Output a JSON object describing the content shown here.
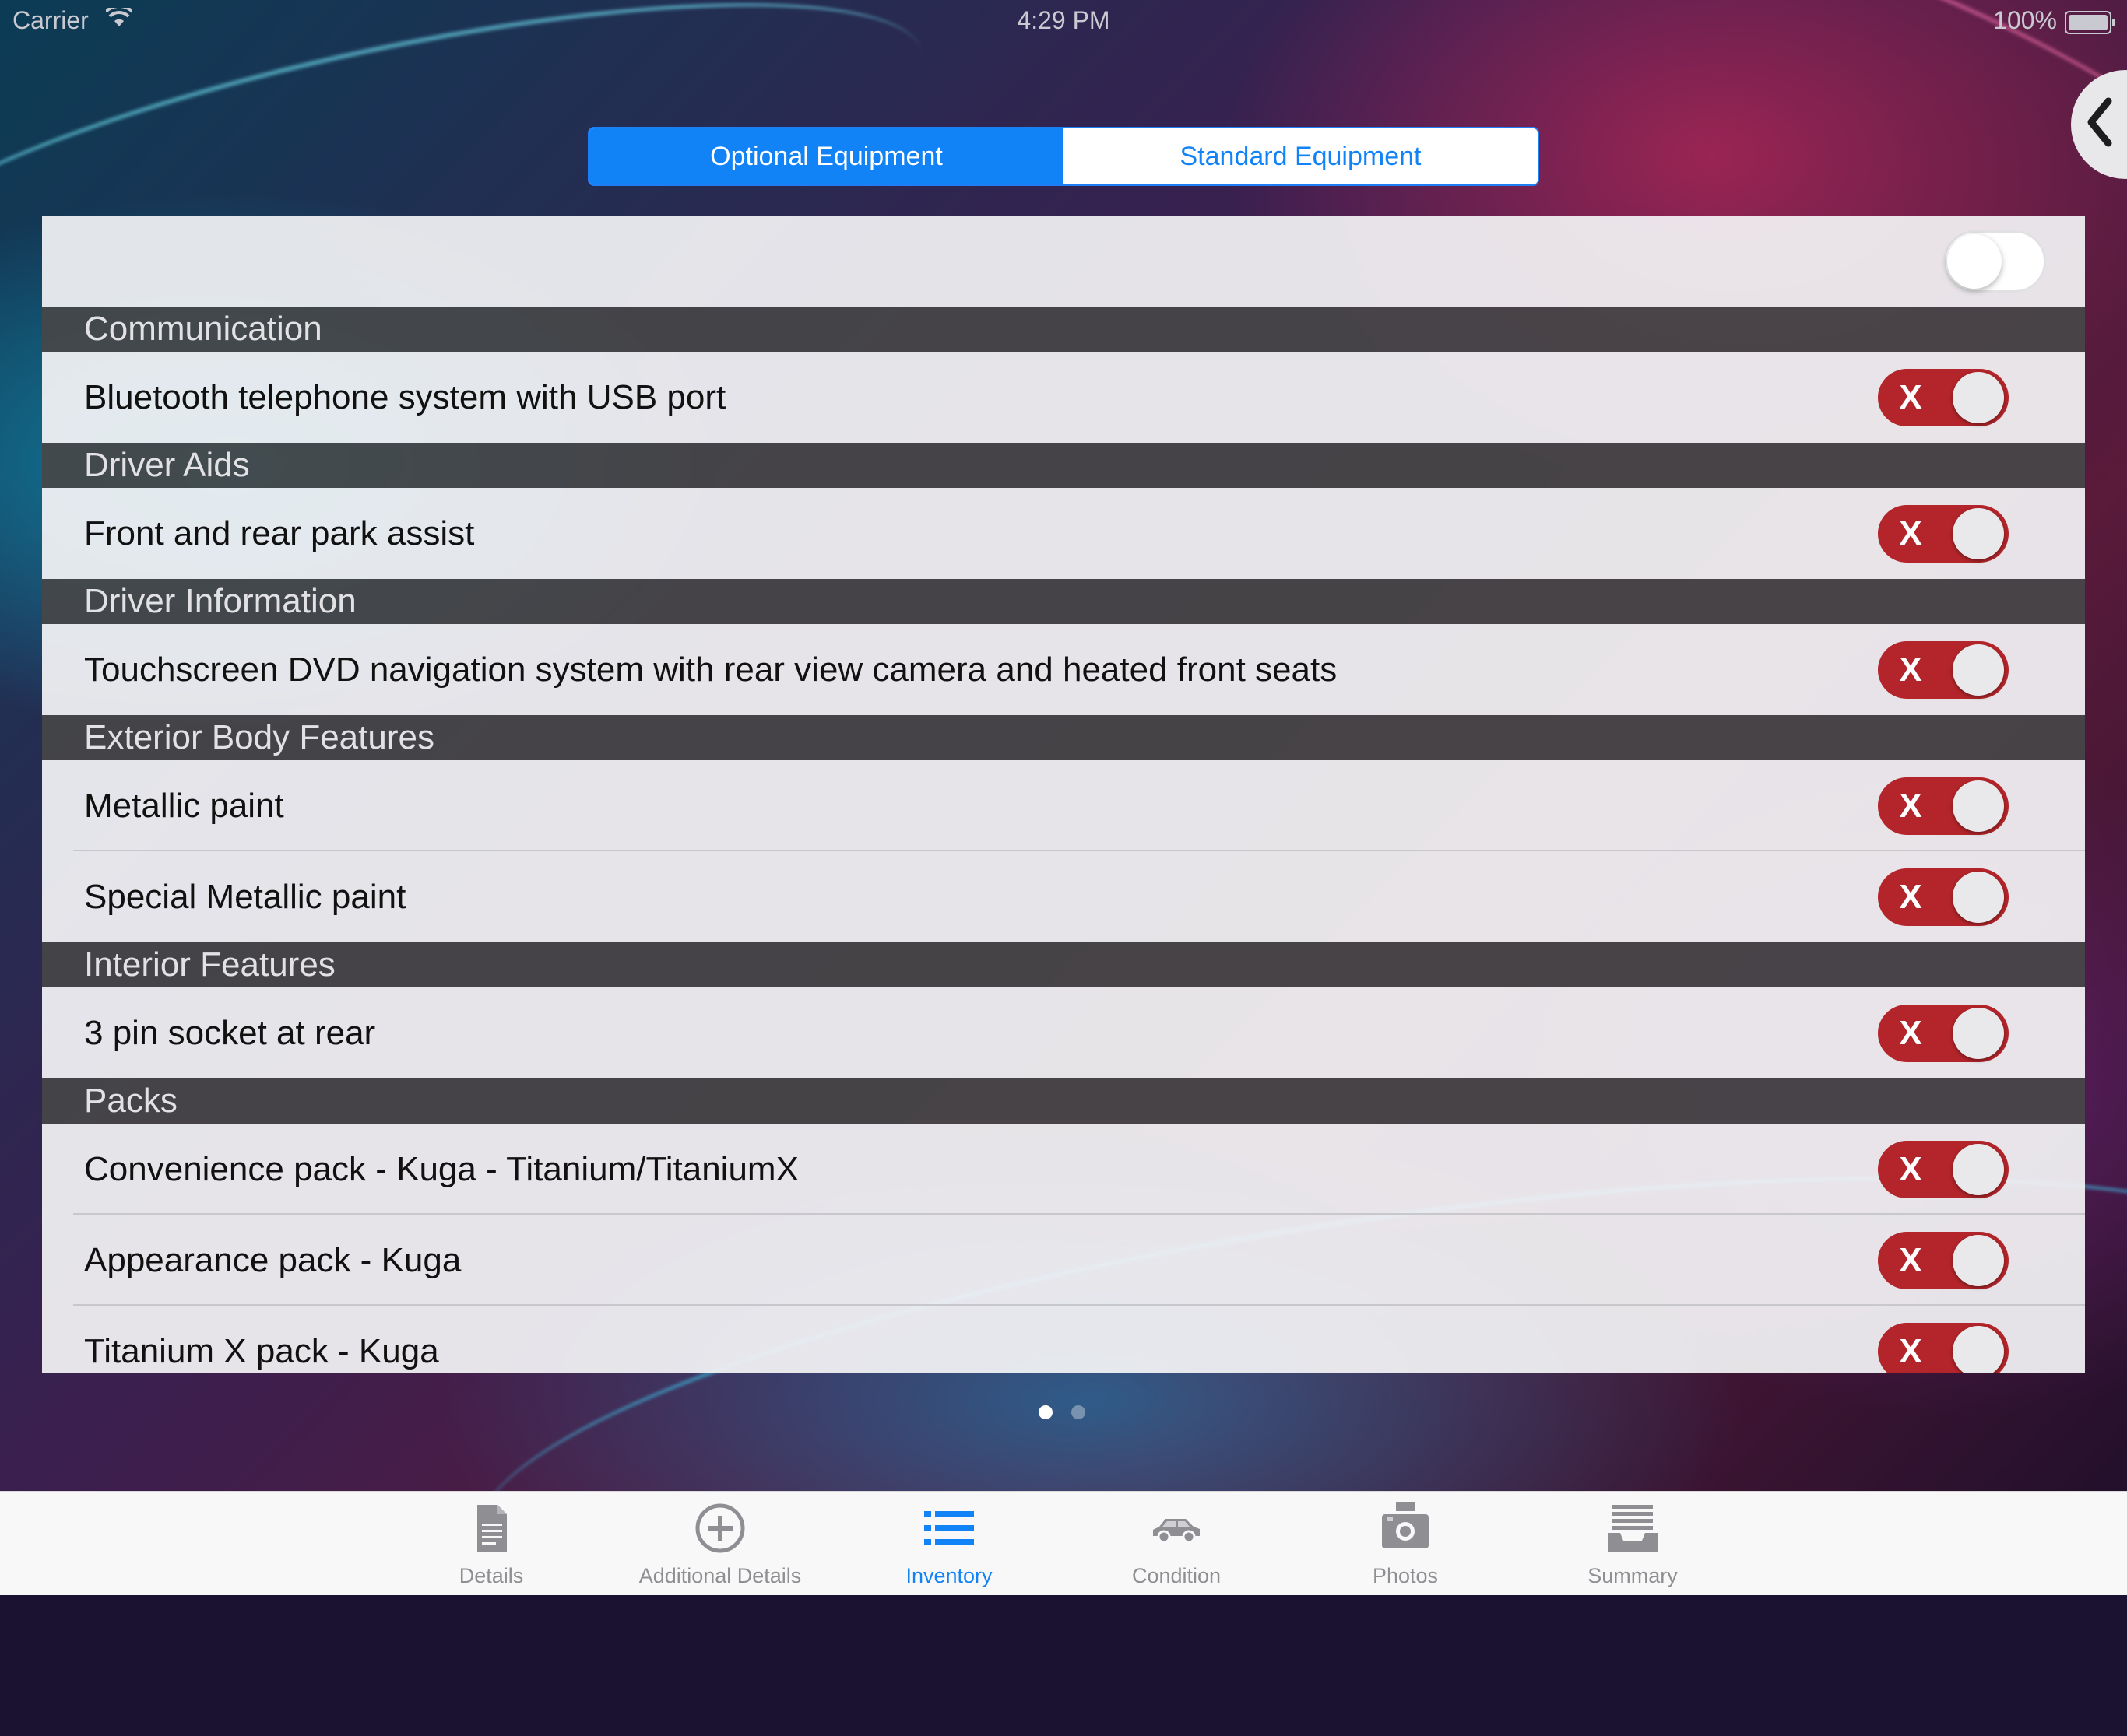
{
  "status_bar": {
    "carrier": "Carrier",
    "time": "4:29 PM",
    "battery": "100%"
  },
  "segments": {
    "optional": "Optional Equipment",
    "standard": "Standard Equipment",
    "selected": "optional"
  },
  "sections": [
    {
      "title": "Communication",
      "items": [
        "Bluetooth telephone system with USB port"
      ]
    },
    {
      "title": "Driver Aids",
      "items": [
        "Front and rear park assist"
      ]
    },
    {
      "title": "Driver Information",
      "items": [
        "Touchscreen DVD navigation system with rear view camera and heated front seats"
      ]
    },
    {
      "title": "Exterior Body Features",
      "items": [
        "Metallic paint",
        "Special Metallic paint"
      ]
    },
    {
      "title": "Interior Features",
      "items": [
        "3 pin socket at rear"
      ]
    },
    {
      "title": "Packs",
      "items": [
        "Convenience pack - Kuga - Titanium/TitaniumX",
        "Appearance pack - Kuga",
        "Titanium X pack - Kuga"
      ]
    }
  ],
  "toggle_x_label": "X",
  "page_control": {
    "count": 2,
    "current": 1
  },
  "tabs": [
    {
      "label": "Details",
      "icon": "document-icon",
      "active": false
    },
    {
      "label": "Additional Details",
      "icon": "add-circle-icon",
      "active": false
    },
    {
      "label": "Inventory",
      "icon": "list-icon",
      "active": true
    },
    {
      "label": "Condition",
      "icon": "car-icon",
      "active": false
    },
    {
      "label": "Photos",
      "icon": "camera-icon",
      "active": false
    },
    {
      "label": "Summary",
      "icon": "tray-icon",
      "active": false
    }
  ],
  "colors": {
    "accent": "#1283f6",
    "toggle_off_red": "#b3252a",
    "header_bg": "#464648"
  }
}
